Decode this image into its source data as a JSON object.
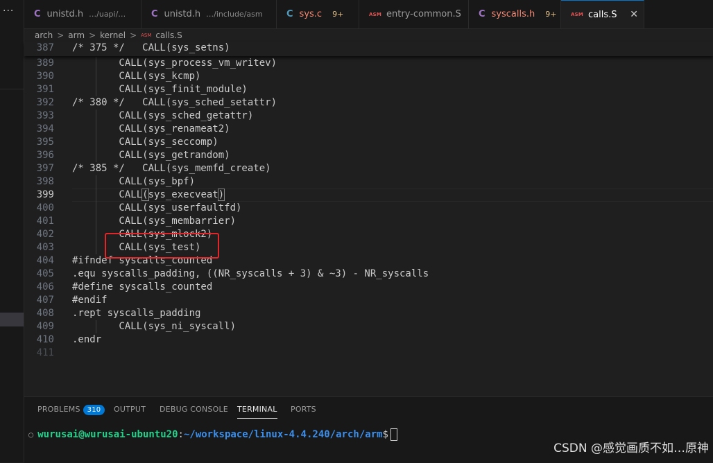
{
  "tabs": [
    {
      "icon": "C",
      "label": "unistd.h",
      "desc": "…/uapi/…",
      "badge": ""
    },
    {
      "icon": "C",
      "label": "unistd.h",
      "desc": "…/include/asm",
      "badge": ""
    },
    {
      "icon": "C",
      "label": "sys.c",
      "desc": "",
      "badge": "9+"
    },
    {
      "icon": "ASM",
      "label": "entry-common.S",
      "desc": "",
      "badge": ""
    },
    {
      "icon": "C",
      "label": "syscalls.h",
      "desc": "",
      "badge": "9+"
    },
    {
      "icon": "ASM",
      "label": "calls.S",
      "desc": "",
      "badge": ""
    }
  ],
  "close_glyph": "✕",
  "more_glyph": "···",
  "breadcrumb": {
    "items": [
      "arch",
      "arm",
      "kernel"
    ],
    "file": "calls.S",
    "file_icon": "ASM",
    "chevron": ">"
  },
  "sticky": {
    "num": "387",
    "text": "/* 375 */   CALL(sys_setns)"
  },
  "lines": [
    {
      "num": "389",
      "text": "        CALL(sys_process_vm_writev)"
    },
    {
      "num": "390",
      "text": "        CALL(sys_kcmp)"
    },
    {
      "num": "391",
      "text": "        CALL(sys_finit_module)"
    },
    {
      "num": "392",
      "text": "/* 380 */   CALL(sys_sched_setattr)"
    },
    {
      "num": "393",
      "text": "        CALL(sys_sched_getattr)"
    },
    {
      "num": "394",
      "text": "        CALL(sys_renameat2)"
    },
    {
      "num": "395",
      "text": "        CALL(sys_seccomp)"
    },
    {
      "num": "396",
      "text": "        CALL(sys_getrandom)"
    },
    {
      "num": "397",
      "text": "/* 385 */   CALL(sys_memfd_create)"
    },
    {
      "num": "398",
      "text": "        CALL(sys_bpf)"
    },
    {
      "num": "399",
      "pre": "        CALL",
      "b1": "(",
      "mid": "sys_execveat",
      "b2": ")"
    },
    {
      "num": "400",
      "text": "        CALL(sys_userfaultfd)"
    },
    {
      "num": "401",
      "text": "        CALL(sys_membarrier)"
    },
    {
      "num": "402",
      "text": "        CALL(sys_mlock2)"
    },
    {
      "num": "403",
      "text": "        CALL(sys_test)"
    },
    {
      "num": "404",
      "text": "#ifndef syscalls_counted"
    },
    {
      "num": "405",
      "text": ".equ syscalls_padding, ((NR_syscalls + 3) & ~3) - NR_syscalls"
    },
    {
      "num": "406",
      "text": "#define syscalls_counted"
    },
    {
      "num": "407",
      "text": "#endif"
    },
    {
      "num": "408",
      "text": ".rept syscalls_padding"
    },
    {
      "num": "409",
      "text": "        CALL(sys_ni_syscall)"
    },
    {
      "num": "410",
      "text": ".endr"
    },
    {
      "num": "411",
      "text": ""
    }
  ],
  "panel": {
    "tabs": [
      "PROBLEMS",
      "OUTPUT",
      "DEBUG CONSOLE",
      "TERMINAL",
      "PORTS"
    ],
    "problems_count": "310"
  },
  "terminal": {
    "bullet": "○",
    "user": "wurusai@wurusai-ubuntu20",
    "sep": ":",
    "path": "~/workspace/linux-4.4.240/arch/arm",
    "prompt": "$"
  },
  "watermark": "CSDN @感觉画质不如…原神",
  "colors": {
    "accent": "#0078d4",
    "highlight_box": "#e0282b",
    "terminal_user": "#23d18b",
    "terminal_path": "#3b8eea"
  }
}
